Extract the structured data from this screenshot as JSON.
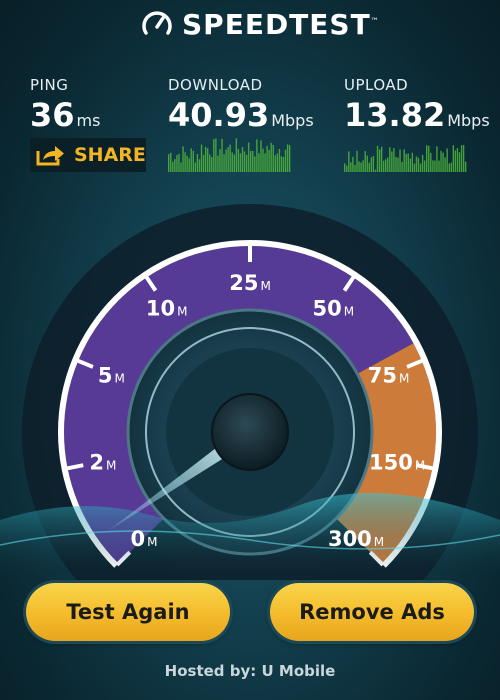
{
  "app": {
    "title": "SPEEDTEST",
    "trademark": "™",
    "logo_icon": "speedometer-icon"
  },
  "metrics": {
    "ping": {
      "label": "PING",
      "value": "36",
      "unit": "ms"
    },
    "download": {
      "label": "DOWNLOAD",
      "value": "40.93",
      "unit": "Mbps"
    },
    "upload": {
      "label": "UPLOAD",
      "value": "13.82",
      "unit": "Mbps"
    }
  },
  "share": {
    "label": "SHARE",
    "icon": "share-icon"
  },
  "gauge": {
    "scale_labels": [
      {
        "num": "0",
        "unit": "M"
      },
      {
        "num": "2",
        "unit": "M"
      },
      {
        "num": "5",
        "unit": "M"
      },
      {
        "num": "10",
        "unit": "M"
      },
      {
        "num": "25",
        "unit": "M"
      },
      {
        "num": "50",
        "unit": "M"
      },
      {
        "num": "75",
        "unit": "M"
      },
      {
        "num": "150",
        "unit": "M"
      },
      {
        "num": "300",
        "unit": "M"
      }
    ],
    "needle_value_mbps": 0.6
  },
  "buttons": {
    "test_again": "Test Again",
    "remove_ads": "Remove Ads"
  },
  "footer": {
    "hosted_by": "Hosted by: U Mobile"
  },
  "colors": {
    "accent_yellow": "#f4bb2c",
    "spark_green": "#4fb63a",
    "gauge_purple": "#5b3c9c",
    "gauge_orange": "#d8813b"
  }
}
